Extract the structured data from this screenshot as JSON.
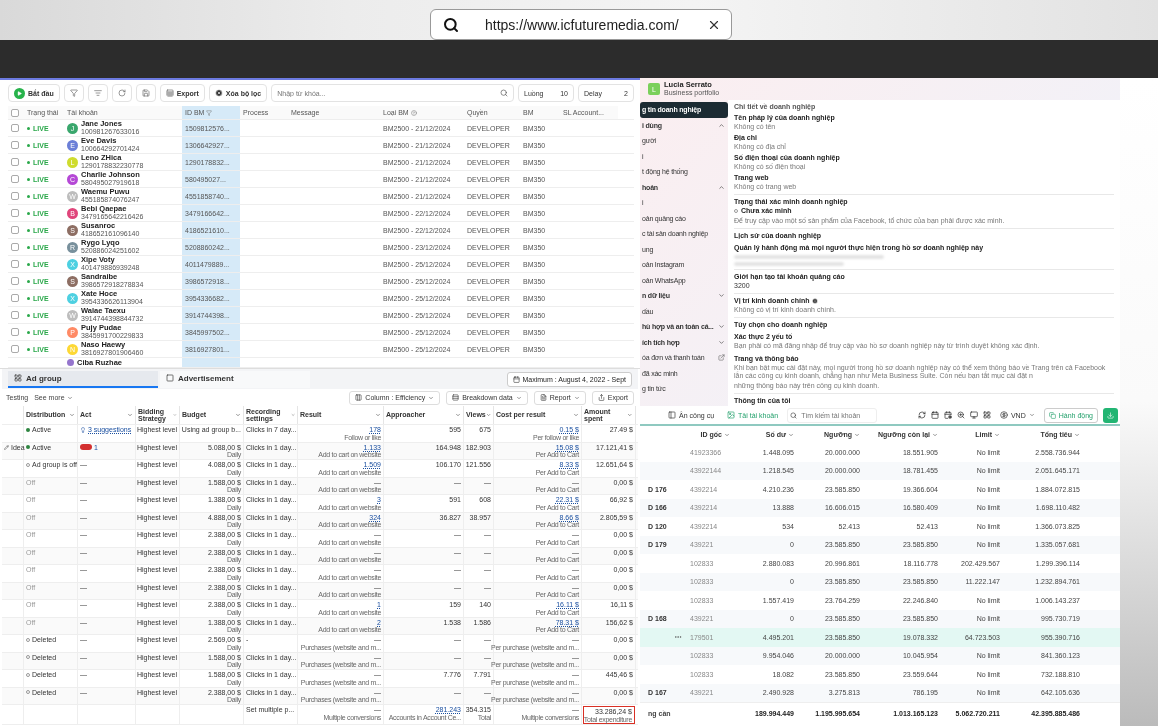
{
  "browser_bar": {
    "url": "https://www.icfuturemedia.com/"
  },
  "account_tool": {
    "toolbar": {
      "start": "Bắt đầu",
      "export": "Export",
      "clear_filter": "Xóa bộ lọc",
      "search_placeholder": "Nhập từ khóa...",
      "threads_label": "Luồng",
      "threads_value": "10",
      "delay_label": "Delay",
      "delay_value": "2"
    },
    "select_all_checked": false,
    "columns": [
      {
        "label": "Trạng thái",
        "selected": false
      },
      {
        "label": "Tài khoản",
        "selected": false
      },
      {
        "label": "ID BM",
        "selected": true
      },
      {
        "label": "Process",
        "selected": false
      },
      {
        "label": "Message",
        "selected": false
      },
      {
        "label": "Loại BM",
        "selected": false
      },
      {
        "label": "Quyền",
        "selected": false
      },
      {
        "label": "BM",
        "selected": false
      },
      {
        "label": "SL Account...",
        "selected": false
      }
    ],
    "rows": [
      {
        "checked": false,
        "status": "LIVE",
        "initial": "J",
        "color": "#3aa76d",
        "name": "Jane Jones",
        "account_id": "100981267633016",
        "bm_id": "1509812576...",
        "bm_type": "BM2500 - 21/12/2024",
        "role": "DEVELOPER",
        "bm": "BM350"
      },
      {
        "checked": false,
        "status": "LIVE",
        "initial": "E",
        "color": "#6b7fd7",
        "name": "Eve Davis",
        "account_id": "100664292701424",
        "bm_id": "1306642927...",
        "bm_type": "BM2500 - 21/12/2024",
        "role": "DEVELOPER",
        "bm": "BM350"
      },
      {
        "checked": false,
        "status": "LIVE",
        "initial": "L",
        "color": "#cfdc2e",
        "name": "Leno ZHica",
        "account_id": "1290178832230778",
        "bm_id": "1290178832...",
        "bm_type": "BM2500 - 21/12/2024",
        "role": "DEVELOPER",
        "bm": "BM350"
      },
      {
        "checked": false,
        "status": "LIVE",
        "initial": "C",
        "color": "#b548d6",
        "name": "Charlie Johnson",
        "account_id": "580495027919618",
        "bm_id": "580495027...",
        "bm_type": "BM2500 - 21/12/2024",
        "role": "DEVELOPER",
        "bm": "BM350"
      },
      {
        "checked": false,
        "status": "LIVE",
        "initial": "W",
        "color": "#bdbdbd",
        "name": "Waemu Puwu",
        "account_id": "455185874076247",
        "bm_id": "4551858740...",
        "bm_type": "BM2500 - 21/12/2024",
        "role": "DEVELOPER",
        "bm": "BM350"
      },
      {
        "checked": false,
        "status": "LIVE",
        "initial": "B",
        "color": "#e0457b",
        "name": "Bebi Qaepae",
        "account_id": "3479165642216426",
        "bm_id": "3479166642...",
        "bm_type": "BM2500 - 22/12/2024",
        "role": "DEVELOPER",
        "bm": "BM350"
      },
      {
        "checked": false,
        "status": "LIVE",
        "initial": "S",
        "color": "#8d6e63",
        "name": "Susanroc",
        "account_id": "418652161096140",
        "bm_id": "4186521610...",
        "bm_type": "BM2500 - 22/12/2024",
        "role": "DEVELOPER",
        "bm": "BM350"
      },
      {
        "checked": false,
        "status": "LIVE",
        "initial": "R",
        "color": "#78909c",
        "name": "Rygo Lyqo",
        "account_id": "520886024251602",
        "bm_id": "5208860242...",
        "bm_type": "BM2500 - 23/12/2024",
        "role": "DEVELOPER",
        "bm": "BM350"
      },
      {
        "checked": false,
        "status": "LIVE",
        "initial": "X",
        "color": "#4dd0e1",
        "name": "Xipe Voty",
        "account_id": "401479886939248",
        "bm_id": "4011479889...",
        "bm_type": "BM2500 - 25/12/2024",
        "role": "DEVELOPER",
        "bm": "BM350"
      },
      {
        "checked": false,
        "status": "LIVE",
        "initial": "S",
        "color": "#8d6e63",
        "name": "Sandraibe",
        "account_id": "3986572918278834",
        "bm_id": "3986572918...",
        "bm_type": "BM2500 - 25/12/2024",
        "role": "DEVELOPER",
        "bm": "BM350"
      },
      {
        "checked": false,
        "status": "LIVE",
        "initial": "X",
        "color": "#4dd0e1",
        "name": "Xate Hoce",
        "account_id": "3954336626113904",
        "bm_id": "3954336682...",
        "bm_type": "BM2500 - 25/12/2024",
        "role": "DEVELOPER",
        "bm": "BM350"
      },
      {
        "checked": false,
        "status": "LIVE",
        "initial": "W",
        "color": "#bdbdbd",
        "name": "Walae Taexu",
        "account_id": "3914744398844732",
        "bm_id": "3914744398...",
        "bm_type": "BM2500 - 25/12/2024",
        "role": "DEVELOPER",
        "bm": "BM350"
      },
      {
        "checked": false,
        "status": "LIVE",
        "initial": "P",
        "color": "#ff8a65",
        "name": "Pujy Pudae",
        "account_id": "3845991700229833",
        "bm_id": "3845997502...",
        "bm_type": "BM2500 - 25/12/2024",
        "role": "DEVELOPER",
        "bm": "BM350"
      },
      {
        "checked": false,
        "status": "LIVE",
        "initial": "N",
        "color": "#fdd835",
        "name": "Naso Haewy",
        "account_id": "3816927801906460",
        "bm_id": "3816927801...",
        "bm_type": "BM2500 - 25/12/2024",
        "role": "DEVELOPER",
        "bm": "BM350"
      }
    ],
    "partial_row": {
      "name": "Ciba Ruzhae",
      "color": "#9575cd"
    }
  },
  "ad_manager": {
    "tabs": [
      {
        "label": "Ad group",
        "selected": true
      },
      {
        "label": "Advertisement",
        "selected": false
      }
    ],
    "date_range": "Maximum : August 4, 2022 - Sept",
    "links": [
      "Testing",
      "See more"
    ],
    "actions": [
      "Column : Efficiency",
      "Breakdown data",
      "Report",
      "Export"
    ],
    "columns": [
      "Distribution",
      "Act",
      "Bidding Strategy",
      "Budget",
      "Recording settings",
      "Result",
      "Approacher",
      "Views",
      "Cost per result",
      "Amount spent"
    ],
    "rows": [
      {
        "kind": "active",
        "status": "Active",
        "act": {
          "kind": "suggestions",
          "text": "3 suggestions"
        },
        "bidding": "Highest level",
        "budget": "Using ad group b...",
        "recording": "Clicks in 7 day...",
        "result": "178",
        "result_note": "Follow or like",
        "approacher": "595",
        "views": "675",
        "cost": "0.15 $",
        "cost_note": "Per follow or like",
        "amount": "27.49 $"
      },
      {
        "note": "Idea",
        "kind": "active",
        "status": "Active",
        "act": {
          "kind": "issues",
          "text": "1"
        },
        "bidding": "Highest level",
        "budget": "5.088,00 $",
        "budget_note": "Daily",
        "recording": "Clicks in 1 day...",
        "result": "1.133",
        "result_note": "Add to cart on website",
        "approacher": "164.948",
        "views": "182.903",
        "cost": "15.08 $",
        "cost_note": "Per Add to Cart",
        "amount": "17.121,41 $"
      },
      {
        "kind": "inactive",
        "status": "Ad group is off",
        "act": {
          "kind": "none",
          "text": "—"
        },
        "bidding": "Highest level",
        "budget": "4.088,00 $",
        "budget_note": "Daily",
        "recording": "Clicks in 1 day...",
        "result": "1.509",
        "result_note": "Add to cart on website",
        "approacher": "106.170",
        "views": "121.556",
        "cost": "8.33 $",
        "cost_note": "Per Add to Cart",
        "amount": "12.651,64 $"
      },
      {
        "kind": "off",
        "status": "Off",
        "act": {
          "kind": "none",
          "text": "—"
        },
        "bidding": "Highest level",
        "budget": "1.588,00 $",
        "budget_note": "Daily",
        "recording": "Clicks in 1 day...",
        "result": "—",
        "result_note": "Add to cart on website",
        "approacher": "—",
        "views": "—",
        "cost": "—",
        "cost_note": "Per Add to Cart",
        "amount": "0,00 $"
      },
      {
        "kind": "off",
        "status": "Off",
        "act": {
          "kind": "none",
          "text": "—"
        },
        "bidding": "Highest level",
        "budget": "1.388,00 $",
        "budget_note": "Daily",
        "recording": "Clicks in 1 day...",
        "result": "3",
        "result_note": "Add to cart on website",
        "approacher": "591",
        "views": "608",
        "cost": "22.31 $",
        "cost_note": "Per Add to Cart",
        "amount": "66,92 $"
      },
      {
        "kind": "off",
        "status": "Off",
        "act": {
          "kind": "none",
          "text": "—"
        },
        "bidding": "Highest level",
        "budget": "4.888,00 $",
        "budget_note": "Daily",
        "recording": "Clicks in 1 day...",
        "result": "324",
        "result_note": "Add to cart on website",
        "approacher": "36.827",
        "views": "38.957",
        "cost": "8.66 $",
        "cost_note": "Per Add to Cart",
        "amount": "2.805,59 $"
      },
      {
        "kind": "off",
        "status": "Off",
        "act": {
          "kind": "none",
          "text": "—"
        },
        "bidding": "Highest level",
        "budget": "2.388,00 $",
        "budget_note": "Daily",
        "recording": "Clicks in 1 day...",
        "result": "—",
        "result_note": "Add to cart on website",
        "approacher": "—",
        "views": "—",
        "cost": "—",
        "cost_note": "Per Add to Cart",
        "amount": "0,00 $"
      },
      {
        "kind": "off",
        "status": "Off",
        "act": {
          "kind": "none",
          "text": "—"
        },
        "bidding": "Highest level",
        "budget": "2.388,00 $",
        "budget_note": "Daily",
        "recording": "Clicks in 1 day...",
        "result": "—",
        "result_note": "Add to cart on website",
        "approacher": "—",
        "views": "—",
        "cost": "—",
        "cost_note": "Per Add to Cart",
        "amount": "0,00 $"
      },
      {
        "kind": "off",
        "status": "Off",
        "act": {
          "kind": "none",
          "text": "—"
        },
        "bidding": "Highest level",
        "budget": "2.388,00 $",
        "budget_note": "Daily",
        "recording": "Clicks in 1 day...",
        "result": "—",
        "result_note": "Add to cart on website",
        "approacher": "—",
        "views": "—",
        "cost": "—",
        "cost_note": "Per Add to Cart",
        "amount": "0,00 $"
      },
      {
        "kind": "off",
        "status": "Off",
        "act": {
          "kind": "none",
          "text": "—"
        },
        "bidding": "Highest level",
        "budget": "2.388,00 $",
        "budget_note": "Daily",
        "recording": "Clicks in 1 day...",
        "result": "—",
        "result_note": "Add to cart on website",
        "approacher": "—",
        "views": "—",
        "cost": "—",
        "cost_note": "Per Add to Cart",
        "amount": "0,00 $"
      },
      {
        "kind": "off",
        "status": "Off",
        "act": {
          "kind": "none",
          "text": "—"
        },
        "bidding": "Highest level",
        "budget": "2.388,00 $",
        "budget_note": "Daily",
        "recording": "Clicks in 1 day...",
        "result": "1",
        "result_note": "Add to cart on website",
        "approacher": "159",
        "views": "140",
        "cost": "16.11 $",
        "cost_note": "Per Add to Cart",
        "amount": "16,11 $"
      },
      {
        "kind": "off",
        "status": "Off",
        "act": {
          "kind": "none",
          "text": "—"
        },
        "bidding": "Highest level",
        "budget": "1.388,00 $",
        "budget_note": "Daily",
        "recording": "Clicks in 1 day...",
        "result": "2",
        "result_note": "Add to cart on website",
        "approacher": "1.538",
        "views": "1.586",
        "cost": "78.31 $",
        "cost_note": "Per Add to Cart",
        "amount": "156,62 $"
      },
      {
        "kind": "inactive",
        "status": "Deleted",
        "act": {
          "kind": "none",
          "text": "—"
        },
        "bidding": "Highest level",
        "budget": "2.569,00 $",
        "budget_note": "Daily",
        "recording": "-",
        "result": "—",
        "result_note": "Purchases (website and m...",
        "approacher": "—",
        "views": "—",
        "cost": "—",
        "cost_note": "Per purchase (website and m...",
        "amount": "0,00 $"
      },
      {
        "kind": "inactive",
        "status": "Deleted",
        "act": {
          "kind": "none",
          "text": "—"
        },
        "bidding": "Highest level",
        "budget": "1.588,00 $",
        "budget_note": "Daily",
        "recording": "Clicks in 1 day...",
        "result": "—",
        "result_note": "Purchases (website and m...",
        "approacher": "—",
        "views": "—",
        "cost": "—",
        "cost_note": "Per purchase (website and m...",
        "amount": "0,00 $"
      },
      {
        "kind": "inactive",
        "status": "Deleted",
        "act": {
          "kind": "none",
          "text": "—"
        },
        "bidding": "Highest level",
        "budget": "1.588,00 $",
        "budget_note": "Daily",
        "recording": "Clicks in 1 day...",
        "result": "—",
        "result_note": "Purchases (website and m...",
        "approacher": "7.776",
        "views": "7.791",
        "cost": "—",
        "cost_note": "Per purchase (website and m...",
        "amount": "445,46 $"
      },
      {
        "kind": "inactive",
        "status": "Deleted",
        "act": {
          "kind": "none",
          "text": "—"
        },
        "bidding": "Highest level",
        "budget": "2.388,00 $",
        "budget_note": "Daily",
        "recording": "Clicks in 1 day...",
        "result": "—",
        "result_note": "Purchases (website and m...",
        "approacher": "—",
        "views": "—",
        "cost": "—",
        "cost_note": "Per purchase (website and m...",
        "amount": "0,00 $"
      }
    ],
    "total": {
      "recording": "Set multiple p...",
      "result": "—",
      "result_note": "Multiple conversions",
      "approacher": "281.243",
      "approacher_note": "Accounts in Account Ce...",
      "views": "354.315",
      "views_note": "Total",
      "cost": "—",
      "cost_note": "Multiple conversions",
      "amount": "33.286,24 $",
      "amount_note": "Total expenditure",
      "amount_highlighted": true
    }
  },
  "business_settings": {
    "profile": {
      "initial": "L",
      "name": "Lucia Serrato",
      "subtitle": "Business portfolio"
    },
    "sidebar": [
      {
        "kind": "item",
        "label": "g tin doanh nghiệp",
        "selected": true
      },
      {
        "kind": "section",
        "label": "i dùng",
        "expanded": true,
        "selected": false
      },
      {
        "kind": "item",
        "label": "gười",
        "selected": false
      },
      {
        "kind": "item",
        "label": "i",
        "selected": false
      },
      {
        "kind": "item",
        "label": "t động hệ thống",
        "selected": false
      },
      {
        "kind": "section",
        "label": "hoản",
        "expanded": true,
        "selected": false
      },
      {
        "kind": "item",
        "label": "i",
        "selected": false
      },
      {
        "kind": "item",
        "label": "oản quảng cáo",
        "selected": false
      },
      {
        "kind": "item",
        "label": "c tài sản doanh nghiệp",
        "selected": false
      },
      {
        "kind": "item",
        "label": "ung",
        "selected": false
      },
      {
        "kind": "item",
        "label": "oản Instagram",
        "selected": false
      },
      {
        "kind": "item",
        "label": "oản WhatsApp",
        "selected": false
      },
      {
        "kind": "section",
        "label": "n dữ liệu",
        "expanded": false,
        "selected": false
      },
      {
        "kind": "item",
        "label": "dầu",
        "selected": false
      },
      {
        "kind": "section",
        "label": "hù hợp và an toàn cá...",
        "expanded": false,
        "selected": false
      },
      {
        "kind": "section",
        "label": "ích tích hợp",
        "expanded": false,
        "selected": false
      },
      {
        "kind": "external",
        "label": "óa đơn và thanh toán",
        "selected": false
      },
      {
        "kind": "item",
        "label": "đã xác minh",
        "selected": false
      },
      {
        "kind": "item",
        "label": "g tin tức",
        "selected": false
      }
    ],
    "details_heading": "Chi tiết về doanh nghiệp",
    "fields": [
      {
        "label": "Tên pháp lý của doanh nghiệp",
        "value": "Không có tên"
      },
      {
        "label": "Địa chỉ",
        "value": "Không có địa chỉ"
      },
      {
        "label": "Số điện thoại của doanh nghiệp",
        "value": "Không có số điện thoại"
      },
      {
        "label": "Trang web",
        "value": "Không có trang web"
      }
    ],
    "sections": [
      {
        "kind": "verification",
        "title": "Trạng thái xác minh doanh nghiệp",
        "status": "Chưa xác minh",
        "text": "Để truy cập vào một số sản phẩm của Facebook, tổ chức của bạn phải được xác minh."
      },
      {
        "kind": "history",
        "title": "Lịch sử của doanh nghiệp",
        "subtitle": "Quản lý hành động mà mọi người thực hiện trong hồ sơ doanh nghiệp này"
      },
      {
        "kind": "plain",
        "title": "Giới hạn tạo tài khoản quảng cáo",
        "value": "3200"
      },
      {
        "kind": "info",
        "title": "Vị trí kinh doanh chính",
        "value": "Không có vị trí kinh doanh chính."
      },
      {
        "kind": "options",
        "title": "Tùy chọn cho doanh nghiệp",
        "options": [
          {
            "title": "Xác thực 2 yếu tố",
            "lines": [
              "Bạn phải có mã đăng nhập để truy cập vào hồ sơ doanh nghiệp này từ trình duyệt không xác định."
            ]
          },
          {
            "title": "Trang và thông báo",
            "lines": [
              "Khi bạn bật mục cài đặt này, mọi người trong hồ sơ doanh nghiệp này có thể xem thông báo về Trang trên cả Facebook lẫn các công cụ kinh doanh, chẳng hạn như Meta Business Suite. Còn nếu bạn tắt mục cài đặt n",
              "những thông báo này trên công cụ kinh doanh."
            ]
          }
        ]
      },
      {
        "kind": "heading",
        "title": "Thông tin của tôi"
      }
    ]
  },
  "ad_accounts": {
    "toolbar": {
      "hide_tools": "Ẩn công cụ",
      "load_accounts": "Tải tài khoản",
      "search_placeholder": "Tìm kiếm tài khoản",
      "currency": "VND",
      "actions": "Hành động"
    },
    "columns": [
      "ID gốc",
      "Số dư",
      "Ngưỡng",
      "Ngưỡng còn lại",
      "Limit",
      "Tổng tiêu"
    ],
    "rows": [
      {
        "selected": false,
        "root_id": "41923366",
        "balance": "1.448.095",
        "threshold": "20.000.000",
        "remaining": "18.551.905",
        "limit": "No limit",
        "spent": "2.558.736.944"
      },
      {
        "selected": false,
        "root_id": "43922144",
        "balance": "1.218.545",
        "threshold": "20.000.000",
        "remaining": "18.781.455",
        "limit": "No limit",
        "spent": "2.051.645.171"
      },
      {
        "selected": false,
        "label": "D 176",
        "root_id": "4392214",
        "balance": "4.210.236",
        "threshold": "23.585.850",
        "remaining": "19.366.604",
        "limit": "No limit",
        "spent": "1.884.072.815"
      },
      {
        "selected": false,
        "label": "D 166",
        "root_id": "4392214",
        "balance": "13.888",
        "threshold": "16.606.015",
        "remaining": "16.580.409",
        "limit": "No limit",
        "spent": "1.698.110.482"
      },
      {
        "selected": false,
        "label": "D 120",
        "root_id": "4392214",
        "balance": "534",
        "threshold": "52.413",
        "remaining": "52.413",
        "limit": "No limit",
        "spent": "1.366.073.825"
      },
      {
        "selected": false,
        "label": "D 179",
        "root_id": "439221",
        "balance": "0",
        "threshold": "23.585.850",
        "remaining": "23.585.850",
        "limit": "No limit",
        "spent": "1.335.057.681"
      },
      {
        "selected": false,
        "root_id": "102833",
        "balance": "2.880.083",
        "threshold": "20.996.861",
        "remaining": "18.116.778",
        "limit": "202.429.567",
        "spent": "1.299.396.114"
      },
      {
        "selected": false,
        "root_id": "102833",
        "balance": "0",
        "threshold": "23.585.850",
        "remaining": "23.585.850",
        "limit": "11.222.147",
        "spent": "1.232.894.761"
      },
      {
        "selected": false,
        "root_id": "102833",
        "balance": "1.557.419",
        "threshold": "23.764.259",
        "remaining": "22.246.840",
        "limit": "No limit",
        "spent": "1.006.143.237"
      },
      {
        "selected": false,
        "label": "D 168",
        "root_id": "439221",
        "balance": "0",
        "threshold": "23.585.850",
        "remaining": "23.585.850",
        "limit": "No limit",
        "spent": "995.730.719"
      },
      {
        "selected": true,
        "root_id": "179501",
        "balance": "4.495.201",
        "threshold": "23.585.850",
        "remaining": "19.078.332",
        "limit": "64.723.503",
        "spent": "955.390.716"
      },
      {
        "selected": false,
        "root_id": "102833",
        "balance": "9.954.046",
        "threshold": "20.000.000",
        "remaining": "10.045.954",
        "limit": "No limit",
        "spent": "841.360.123"
      },
      {
        "selected": false,
        "root_id": "102833",
        "balance": "18.082",
        "threshold": "23.585.850",
        "remaining": "23.559.644",
        "limit": "No limit",
        "spent": "732.188.810"
      },
      {
        "selected": false,
        "label": "D 167",
        "root_id": "439221",
        "balance": "2.490.928",
        "threshold": "3.275.813",
        "remaining": "786.195",
        "limit": "No limit",
        "spent": "642.105.636"
      }
    ],
    "total": {
      "label": "ng cần",
      "balance": "189.994.449",
      "threshold": "1.195.995.654",
      "remaining": "1.013.165.123",
      "limit": "5.062.720.211",
      "spent": "42.395.885.486"
    }
  }
}
